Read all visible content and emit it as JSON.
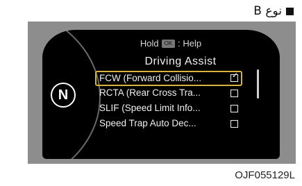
{
  "type_label": "نوع B",
  "display": {
    "help_prefix": "Hold",
    "ok_key": "OK",
    "help_suffix": ": Help",
    "title": "Driving Assist",
    "gear": "N",
    "items": [
      {
        "label": "FCW (Forward Collisio...",
        "checked": true,
        "selected": true
      },
      {
        "label": "RCTA (Rear Cross Tra...",
        "checked": false,
        "selected": false
      },
      {
        "label": "SLIF (Speed Limit Info...",
        "checked": false,
        "selected": false
      },
      {
        "label": "Speed Trap Auto Dec...",
        "checked": false,
        "selected": false
      }
    ]
  },
  "figure_code": "OJF055129L",
  "colors": {
    "selection_border": "#d8b340",
    "screen_bg": "#000000",
    "frame_bg": "#8d8d8d"
  }
}
